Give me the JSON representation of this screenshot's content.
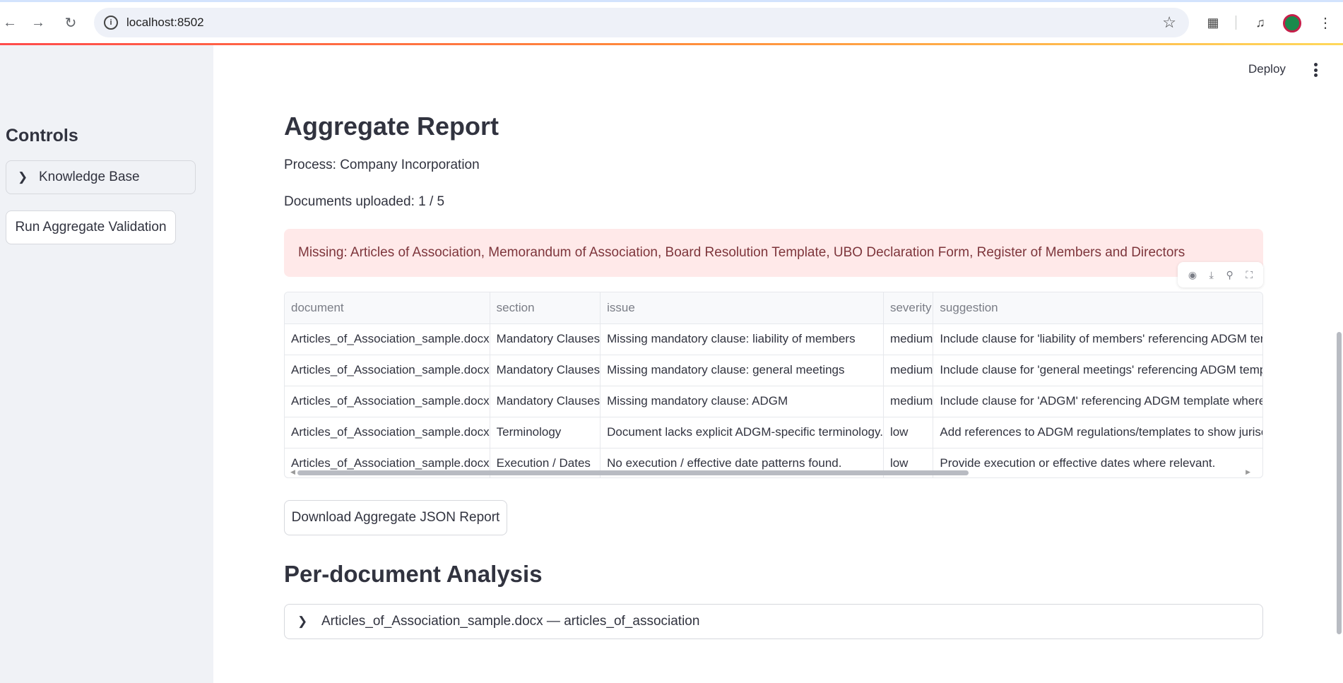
{
  "browser": {
    "url": "localhost:8502"
  },
  "sidebar": {
    "title": "Controls",
    "expander_label": "Knowledge Base",
    "run_button_label": "Run Aggregate Validation"
  },
  "header": {
    "deploy_label": "Deploy"
  },
  "main": {
    "title": "Aggregate Report",
    "process_text": "Process: Company Incorporation",
    "documents_text": "Documents uploaded: 1 / 5",
    "missing_alert": "Missing: Articles of Association, Memorandum of Association, Board Resolution Template, UBO Declaration Form, Register of Members and Directors",
    "table": {
      "columns": [
        "document",
        "section",
        "issue",
        "severity",
        "suggestion"
      ],
      "rows": [
        [
          "Articles_of_Association_sample.docx",
          "Mandatory Clauses",
          "Missing mandatory clause: liability of members",
          "medium",
          "Include clause for 'liability of members' referencing ADGM ter"
        ],
        [
          "Articles_of_Association_sample.docx",
          "Mandatory Clauses",
          "Missing mandatory clause: general meetings",
          "medium",
          "Include clause for 'general meetings' referencing ADGM temp"
        ],
        [
          "Articles_of_Association_sample.docx",
          "Mandatory Clauses",
          "Missing mandatory clause: ADGM",
          "medium",
          "Include clause for 'ADGM' referencing ADGM template where a"
        ],
        [
          "Articles_of_Association_sample.docx",
          "Terminology",
          "Document lacks explicit ADGM-specific terminology.",
          "low",
          "Add references to ADGM regulations/templates to show jurisc"
        ],
        [
          "Articles_of_Association_sample.docx",
          "Execution / Dates",
          "No execution / effective date patterns found.",
          "low",
          "Provide execution or effective dates where relevant."
        ]
      ]
    },
    "download_button_label": "Download Aggregate JSON Report",
    "per_doc_title": "Per-document Analysis",
    "per_doc_expander": "Articles_of_Association_sample.docx — articles_of_association"
  },
  "icons": {
    "back": "back-arrow-icon",
    "forward": "forward-arrow-icon",
    "reload": "reload-icon",
    "info": "site-info-icon",
    "star": "bookmark-star-icon",
    "extensions": "extensions-icon",
    "media": "media-control-icon",
    "profile": "profile-avatar-icon",
    "menu": "chrome-menu-icon",
    "chevron": "chevron-right-icon",
    "eye": "eye-icon",
    "download": "download-icon",
    "search": "search-icon",
    "fullscreen": "fullscreen-icon"
  },
  "colors": {
    "sidebar_bg": "#f0f2f6",
    "alert_bg": "#ffe9e9",
    "alert_text": "#7d353b",
    "text": "#31333f",
    "accent_gradient_start": "#ff4b4b",
    "accent_gradient_end": "#ffd85a"
  }
}
